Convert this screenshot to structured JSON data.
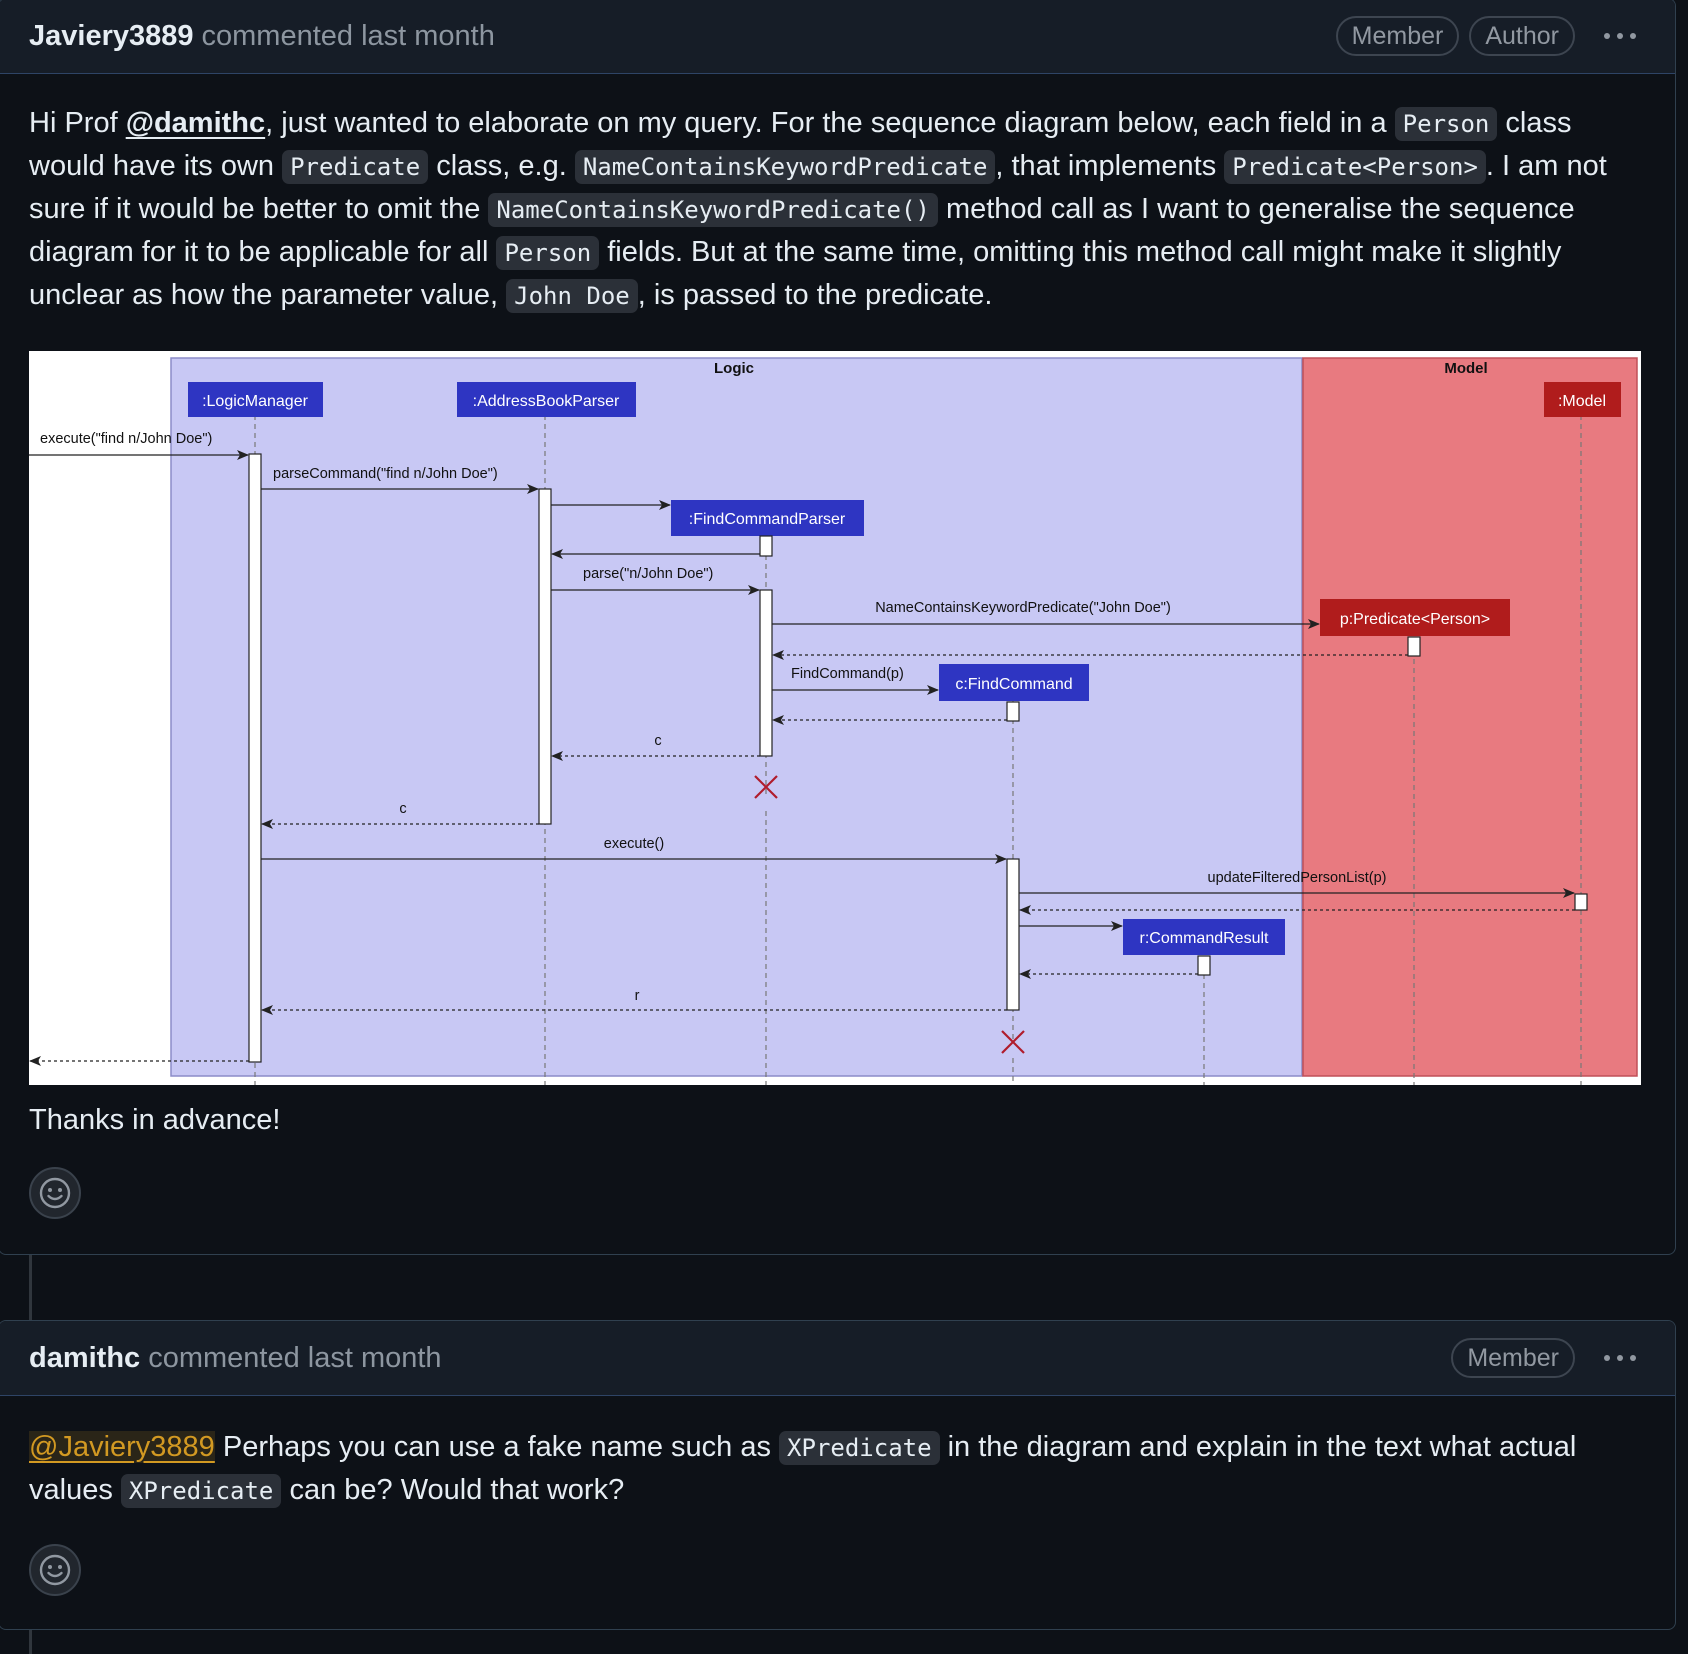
{
  "comments": [
    {
      "author": "Javiery3889",
      "meta": "commented last month",
      "badges": [
        "Member",
        "Author"
      ],
      "body": {
        "p1_a": "Hi Prof ",
        "mention": "@damithc",
        "p1_b": ", just wanted to elaborate on my query. For the sequence diagram below, each field in a ",
        "code1": "Person",
        "p1_c": " class would have its own ",
        "code2": "Predicate",
        "p1_d": " class, e.g. ",
        "code3": "NameContainsKeywordPredicate",
        "p1_e": ", that implements ",
        "code4": "Predicate<Person>",
        "p1_f": ". I am not sure if it would be better to omit the ",
        "code5": "NameContainsKeywordPredicate()",
        "p1_g": " method call as I want to generalise the sequence diagram for it to be applicable for all ",
        "code6": "Person",
        "p1_h": " fields. But at the same time, omitting this method call might make it slightly unclear as how the parameter value, ",
        "code7": "John Doe",
        "p1_i": ", is passed to the predicate.",
        "thanks": "Thanks in advance!"
      }
    },
    {
      "author": "damithc",
      "meta": "commented last month",
      "badges": [
        "Member"
      ],
      "body": {
        "mention": "@Javiery3889",
        "p_a": " Perhaps you can use a fake name such as ",
        "code1": "XPredicate",
        "p_b": " in the diagram and explain in the text what actual values ",
        "code2": "XPredicate",
        "p_c": " can be? Would that work?"
      }
    }
  ],
  "diagram": {
    "frame_logic": "Logic",
    "frame_model": "Model",
    "participants": [
      ":LogicManager",
      ":AddressBookParser",
      ":FindCommandParser",
      "p:Predicate<Person>",
      "c:FindCommand",
      ":Model",
      "r:CommandResult"
    ],
    "messages": {
      "m1": "execute(\"find n/John Doe\")",
      "m2": "parseCommand(\"find n/John Doe\")",
      "m3": "parse(\"n/John Doe\")",
      "m4": "NameContainsKeywordPredicate(\"John Doe\")",
      "m5": "FindCommand(p)",
      "m6": "c",
      "m7": "c",
      "m8": "execute()",
      "m9": "updateFilteredPersonList(p)",
      "m10": "r"
    }
  },
  "colors": {
    "logic_bg": "#c8c8f4",
    "model_bg": "#e87a80",
    "logic_box": "#2e35c2",
    "model_box": "#b01c1c",
    "destroy": "#b01c2c"
  },
  "icons": [
    "kebab-menu-icon",
    "smiley-icon"
  ]
}
